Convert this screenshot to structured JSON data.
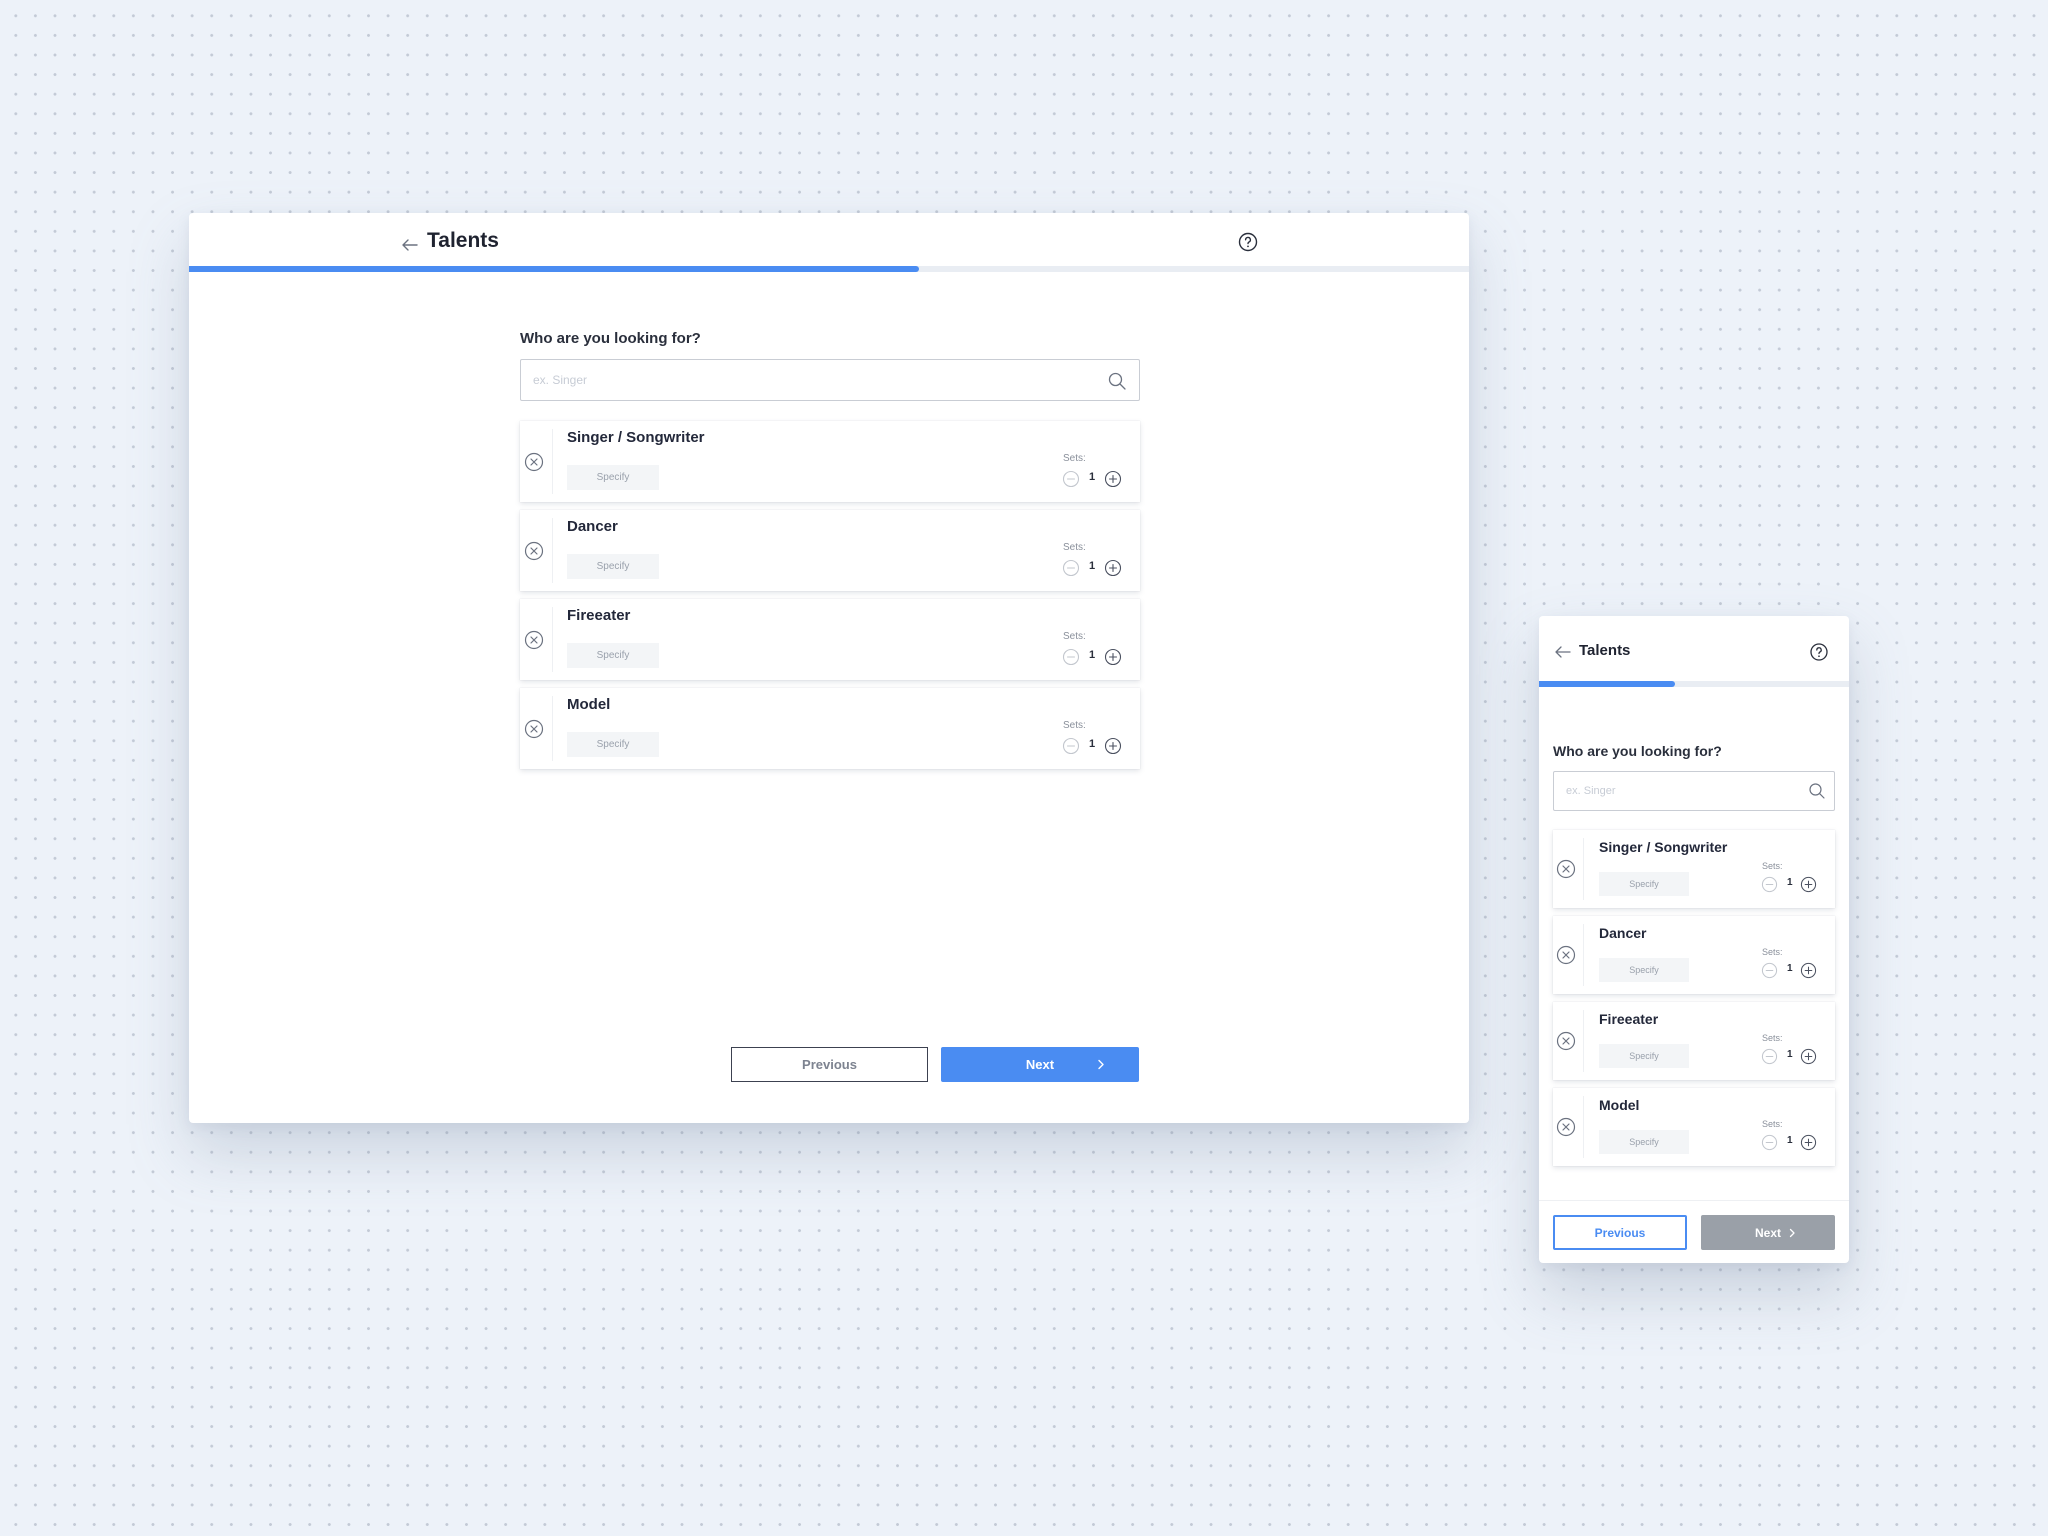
{
  "desktop": {
    "title": "Talents",
    "progress_fraction": 0.57,
    "question": "Who are you looking for?",
    "search_placeholder": "ex. Singer",
    "items": [
      {
        "name": "Singer / Songwriter",
        "specify": "Specify",
        "sets_label": "Sets:",
        "count": "1"
      },
      {
        "name": "Dancer",
        "specify": "Specify",
        "sets_label": "Sets:",
        "count": "1"
      },
      {
        "name": "Fireeater",
        "specify": "Specify",
        "sets_label": "Sets:",
        "count": "1"
      },
      {
        "name": "Model",
        "specify": "Specify",
        "sets_label": "Sets:",
        "count": "1"
      }
    ],
    "previous_label": "Previous",
    "next_label": "Next"
  },
  "mobile": {
    "title": "Talents",
    "progress_fraction": 0.44,
    "question": "Who are you looking for?",
    "search_placeholder": "ex. Singer",
    "items": [
      {
        "name": "Singer / Songwriter",
        "specify": "Specify",
        "sets_label": "Sets:",
        "count": "1"
      },
      {
        "name": "Dancer",
        "specify": "Specify",
        "sets_label": "Sets:",
        "count": "1"
      },
      {
        "name": "Fireeater",
        "specify": "Specify",
        "sets_label": "Sets:",
        "count": "1"
      },
      {
        "name": "Model",
        "specify": "Specify",
        "sets_label": "Sets:",
        "count": "1"
      }
    ],
    "previous_label": "Previous",
    "next_label": "Next"
  },
  "colors": {
    "accent": "#4a8cf2",
    "background": "#edf2f9",
    "disabled_button": "#9aa0a8"
  },
  "icons": [
    "arrow-left-icon",
    "help-circle-icon",
    "search-icon",
    "remove-circle-icon",
    "minus-circle-icon",
    "plus-circle-icon",
    "chevron-right-icon"
  ]
}
